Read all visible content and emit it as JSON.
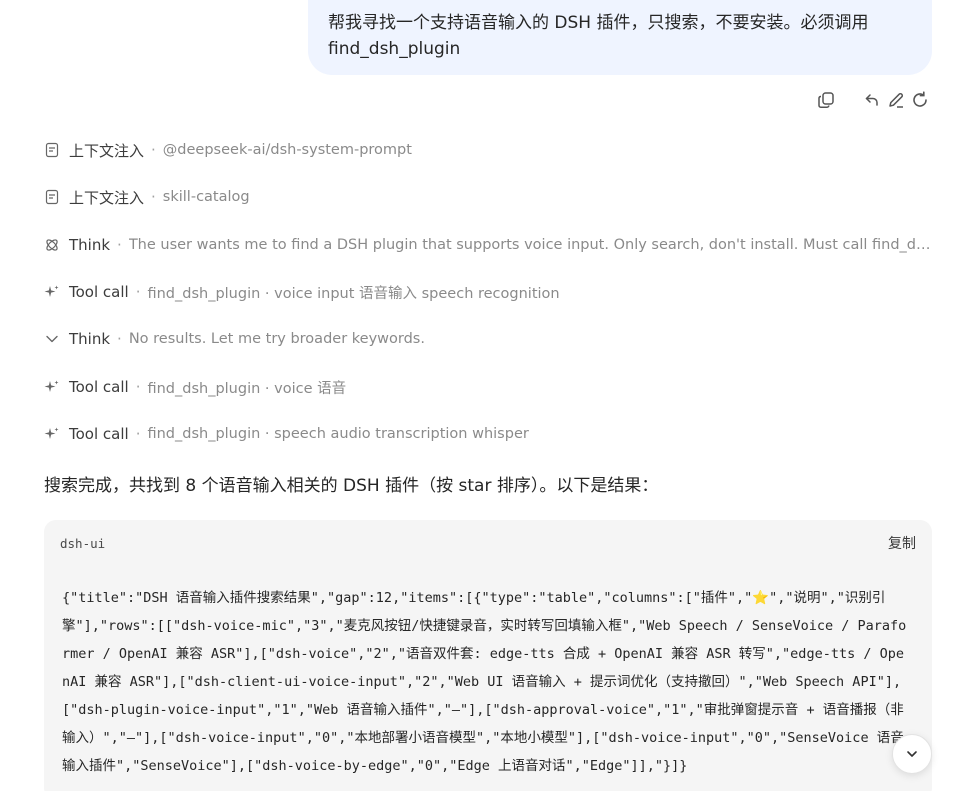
{
  "user_message": "帮我寻找一个支持语音输入的 DSH 插件，只搜索，不要安装。必须调用 find_dsh_plugin",
  "message_actions": [
    "copy-icon",
    "back-arrow-icon",
    "edit-icon",
    "refresh-icon"
  ],
  "steps": [
    {
      "icon": "document-icon",
      "label": "上下文注入",
      "separator": "·",
      "detail": "@deepseek-ai/dsh-system-prompt"
    },
    {
      "icon": "document-icon",
      "label": "上下文注入",
      "separator": "·",
      "detail": "skill-catalog"
    },
    {
      "icon": "think-icon",
      "label": "Think",
      "separator": "·",
      "detail": "The user wants me to find a DSH plugin that supports voice input. Only search, don't install. Must call find_dsh_plugin."
    },
    {
      "icon": "sparkle-icon",
      "label": "Tool call",
      "separator": "·",
      "detail": "find_dsh_plugin · voice input 语音输入 speech recognition"
    },
    {
      "icon": "chevron-down-icon",
      "label": "Think",
      "separator": "·",
      "detail": "No results. Let me try broader keywords."
    },
    {
      "icon": "sparkle-icon",
      "label": "Tool call",
      "separator": "·",
      "detail": "find_dsh_plugin · voice 语音"
    },
    {
      "icon": "sparkle-icon",
      "label": "Tool call",
      "separator": "·",
      "detail": "find_dsh_plugin · speech audio transcription whisper"
    }
  ],
  "answer_text": "搜索完成，共找到 8 个语音输入相关的 DSH 插件（按 star 排序）。以下是结果：",
  "code_block": {
    "language": "dsh-ui",
    "copy_label": "复制",
    "content_before_star": "{\"title\":\"DSH 语音输入插件搜索结果\",\"gap\":12,\"items\":[{\"type\":\"table\",\"columns\":[\"插件\",\"",
    "star": "⭐",
    "content_after_star": "\",\"说明\",\"识别引擎\"],\"rows\":[[\"dsh-voice-mic\",\"3\",\"麦克风按钮/快捷键录音，实时转写回填输入框\",\"Web Speech / SenseVoice / Paraformer / OpenAI 兼容 ASR\"],[\"dsh-voice\",\"2\",\"语音双件套: edge-tts 合成 + OpenAI 兼容 ASR 转写\",\"edge-tts / OpenAI 兼容 ASR\"],[\"dsh-client-ui-voice-input\",\"2\",\"Web UI 语音输入 + 提示词优化（支持撤回）\",\"Web Speech API\"],[\"dsh-plugin-voice-input\",\"1\",\"Web 语音输入插件\",\"—\"],[\"dsh-approval-voice\",\"1\",\"审批弹窗提示音 + 语音播报（非输入）\",\"—\"],[\"dsh-voice-input\",\"0\",\"本地部署小语音模型\",\"本地小模型\"],[\"dsh-voice-input\",\"0\",\"SenseVoice 语音输入插件\",\"SenseVoice\"],[\"dsh-voice-by-edge\",\"0\",\"Edge 上语音对话\",\"Edge\"]],\"}]}"
  },
  "scroll_button": "chevron-down-icon",
  "colors": {
    "user_bubble": "#eff4ff",
    "code_bg": "#f5f5f5",
    "text": "#262626",
    "muted": "#8a8a8a"
  }
}
